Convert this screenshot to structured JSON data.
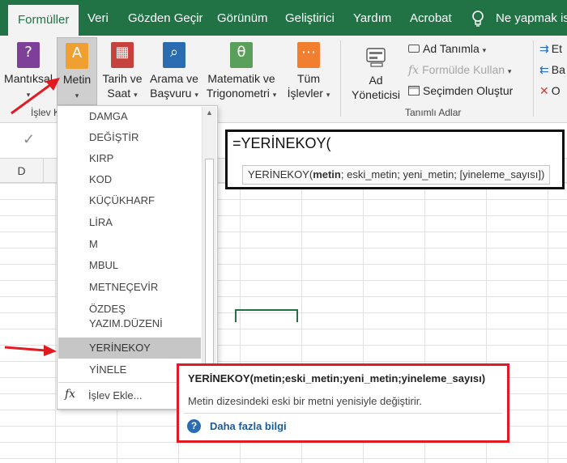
{
  "tabs": [
    {
      "label": "Formüller",
      "active": true
    },
    {
      "label": "Veri"
    },
    {
      "label": "Gözden Geçir"
    },
    {
      "label": "Görünüm"
    },
    {
      "label": "Geliştirici"
    },
    {
      "label": "Yardım"
    },
    {
      "label": "Acrobat"
    },
    {
      "label": "Ne yapmak ist"
    }
  ],
  "ribbon": {
    "mantiksal": "Mantıksal",
    "metin": "Metin",
    "tarih_line1": "Tarih ve",
    "tarih_line2": "Saat",
    "arama_line1": "Arama ve",
    "arama_line2": "Başvuru",
    "matematik_line1": "Matematik ve",
    "matematik_line2": "Trigonometri",
    "tum_line1": "Tüm",
    "tum_line2": "İşlevler",
    "group_islev": "İşlev K",
    "ad_line1": "Ad",
    "ad_line2": "Yöneticisi",
    "ad_tanimla": "Ad Tanımla",
    "formulde_kullan": "Formülde Kullan",
    "secimden_olustur": "Seçimden Oluştur",
    "group_tanimli": "Tanımlı Adlar",
    "right_1": "Et",
    "right_2": "Ba",
    "right_3": "O",
    "caret": "▾"
  },
  "formula_bar": {
    "check": "✓",
    "column_d": "D",
    "formula": "=YERİNEKOY(",
    "syntax_name": "YERİNEKOY(",
    "syntax_bold": "metin",
    "syntax_rest": "; eski_metin; yeni_metin; [yineleme_sayısı])"
  },
  "dropdown": {
    "items": [
      "DAMGA",
      "DEĞİŞTİR",
      "KIRP",
      "KOD",
      "KÜÇÜKHARF",
      "LİRA",
      "M",
      "MBUL",
      "METNEÇEVİR"
    ],
    "ozdes_line1": "ÖZDEŞ",
    "ozdes_line2": "YAZIM.DÜZENİ",
    "selected": "YERİNEKOY",
    "last": "YİNELE",
    "fx": "fx",
    "insert": "İşlev Ekle...",
    "up_arrow": "▲"
  },
  "tooltip": {
    "title": "YERİNEKOY(metin;eski_metin;yeni_metin;yineleme_sayısı)",
    "description": "Metin dizesindeki eski bir metni yenisiyle değiştirir.",
    "help_icon": "?",
    "more": "Daha fazla bilgi"
  },
  "colors": {
    "excel_green": "#217346",
    "highlight_red": "#e21b23"
  }
}
